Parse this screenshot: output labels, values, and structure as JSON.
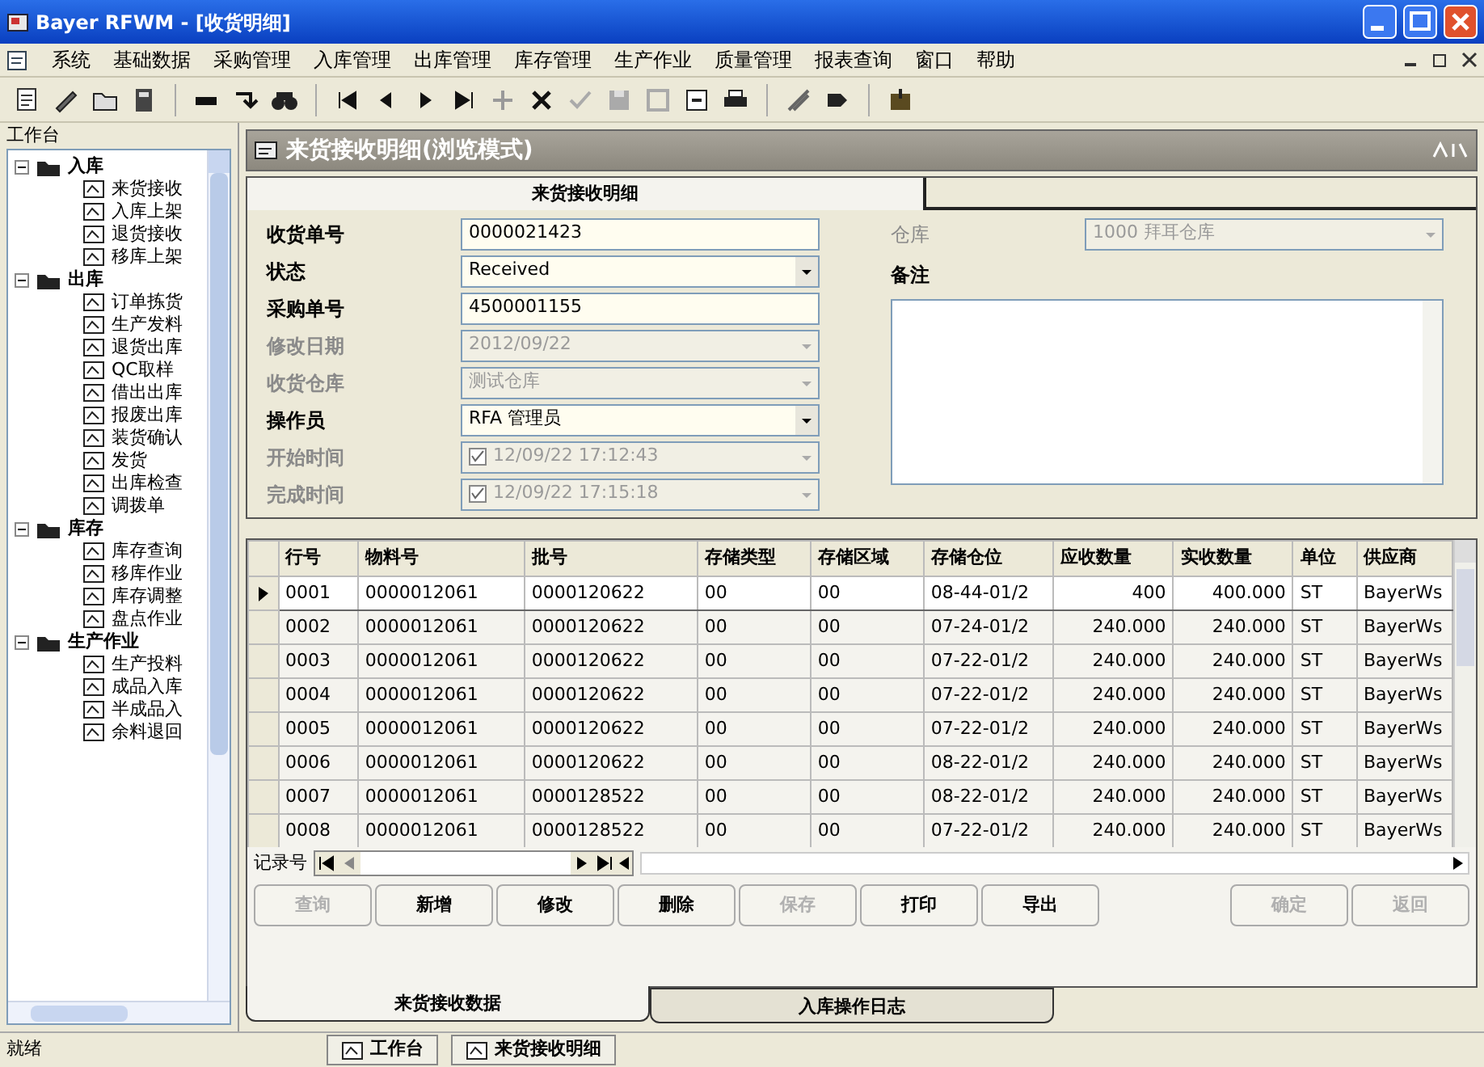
{
  "window": {
    "title": "Bayer RFWM - [收货明细]"
  },
  "menu": [
    "系统",
    "基础数据",
    "采购管理",
    "入库管理",
    "出库管理",
    "库存管理",
    "生产作业",
    "质量管理",
    "报表查询",
    "窗口",
    "帮助"
  ],
  "sidebar": {
    "title": "工作台",
    "tree": [
      {
        "label": "入库",
        "expanded": true,
        "children": [
          {
            "label": "来货接收"
          },
          {
            "label": "入库上架"
          },
          {
            "label": "退货接收"
          },
          {
            "label": "移库上架"
          }
        ]
      },
      {
        "label": "出库",
        "expanded": true,
        "children": [
          {
            "label": "订单拣货"
          },
          {
            "label": "生产发料"
          },
          {
            "label": "退货出库"
          },
          {
            "label": "QC取样"
          },
          {
            "label": "借出出库"
          },
          {
            "label": "报废出库"
          },
          {
            "label": "装货确认"
          },
          {
            "label": "发货"
          },
          {
            "label": "出库检查"
          },
          {
            "label": "调拨单"
          }
        ]
      },
      {
        "label": "库存",
        "expanded": true,
        "children": [
          {
            "label": "库存查询"
          },
          {
            "label": "移库作业"
          },
          {
            "label": "库存调整"
          },
          {
            "label": "盘点作业"
          }
        ]
      },
      {
        "label": "生产作业",
        "expanded": true,
        "children": [
          {
            "label": "生产投料"
          },
          {
            "label": "成品入库"
          },
          {
            "label": "半成品入"
          },
          {
            "label": "余料退回"
          }
        ]
      }
    ]
  },
  "panel": {
    "title": "来货接收明细(浏览模式)",
    "tab": "来货接收明细",
    "fields": [
      {
        "label": "收货单号",
        "kind": "text",
        "value": "0000021423",
        "disabled": false
      },
      {
        "label": "状态",
        "kind": "combo",
        "value": "Received",
        "disabled": false
      },
      {
        "label": "采购单号",
        "kind": "text",
        "value": "4500001155",
        "disabled": false
      },
      {
        "label": "修改日期",
        "kind": "combo",
        "value": "2012/09/22",
        "disabled": true
      },
      {
        "label": "收货仓库",
        "kind": "combo",
        "value": "测试仓库",
        "disabled": true
      },
      {
        "label": "操作员",
        "kind": "combo",
        "value": "RFA 管理员",
        "disabled": false
      },
      {
        "label": "开始时间",
        "kind": "datetime",
        "value": "12/09/22 17:12:43",
        "disabled": true
      },
      {
        "label": "完成时间",
        "kind": "datetime",
        "value": "12/09/22 17:15:18",
        "disabled": true
      }
    ],
    "warehouse": {
      "label": "仓库",
      "value": "1000 拜耳仓库",
      "disabled": true
    },
    "remark": {
      "label": "备注"
    }
  },
  "table": {
    "columns": [
      "行号",
      "物料号",
      "批号",
      "存储类型",
      "存储区域",
      "存储仓位",
      "应收数量",
      "实收数量",
      "单位",
      "供应商"
    ],
    "rows": [
      {
        "selected": true,
        "cells": [
          "0001",
          "0000012061",
          "0000120622",
          "00",
          "00",
          "08-44-01/2",
          "400",
          "400.000",
          "ST",
          "BayerWs"
        ]
      },
      {
        "selected": false,
        "cells": [
          "0002",
          "0000012061",
          "0000120622",
          "00",
          "00",
          "07-24-01/2",
          "240.000",
          "240.000",
          "ST",
          "BayerWs"
        ]
      },
      {
        "selected": false,
        "cells": [
          "0003",
          "0000012061",
          "0000120622",
          "00",
          "00",
          "07-22-01/2",
          "240.000",
          "240.000",
          "ST",
          "BayerWs"
        ]
      },
      {
        "selected": false,
        "cells": [
          "0004",
          "0000012061",
          "0000120622",
          "00",
          "00",
          "07-22-01/2",
          "240.000",
          "240.000",
          "ST",
          "BayerWs"
        ]
      },
      {
        "selected": false,
        "cells": [
          "0005",
          "0000012061",
          "0000120622",
          "00",
          "00",
          "07-22-01/2",
          "240.000",
          "240.000",
          "ST",
          "BayerWs"
        ]
      },
      {
        "selected": false,
        "cells": [
          "0006",
          "0000012061",
          "0000120622",
          "00",
          "00",
          "08-22-01/2",
          "240.000",
          "240.000",
          "ST",
          "BayerWs"
        ]
      },
      {
        "selected": false,
        "cells": [
          "0007",
          "0000012061",
          "0000128522",
          "00",
          "00",
          "08-22-01/2",
          "240.000",
          "240.000",
          "ST",
          "BayerWs"
        ]
      },
      {
        "selected": false,
        "cells": [
          "0008",
          "0000012061",
          "0000128522",
          "00",
          "00",
          "07-22-01/2",
          "240.000",
          "240.000",
          "ST",
          "BayerWs"
        ]
      }
    ]
  },
  "navigator": {
    "label": "记录号"
  },
  "buttons": [
    {
      "label": "查询",
      "disabled": true
    },
    {
      "label": "新增",
      "disabled": false
    },
    {
      "label": "修改",
      "disabled": false
    },
    {
      "label": "删除",
      "disabled": false
    },
    {
      "label": "保存",
      "disabled": true
    },
    {
      "label": "打印",
      "disabled": false
    },
    {
      "label": "导出",
      "disabled": false
    }
  ],
  "buttons_right": [
    {
      "label": "确定",
      "disabled": true
    },
    {
      "label": "返回",
      "disabled": true
    }
  ],
  "bottom_tabs": [
    {
      "label": "来货接收数据",
      "selected": true
    },
    {
      "label": "入库操作日志",
      "selected": false
    }
  ],
  "status_bar": {
    "text": "就绪",
    "windows": [
      {
        "label": "工作台"
      },
      {
        "label": "来货接收明细"
      }
    ]
  }
}
